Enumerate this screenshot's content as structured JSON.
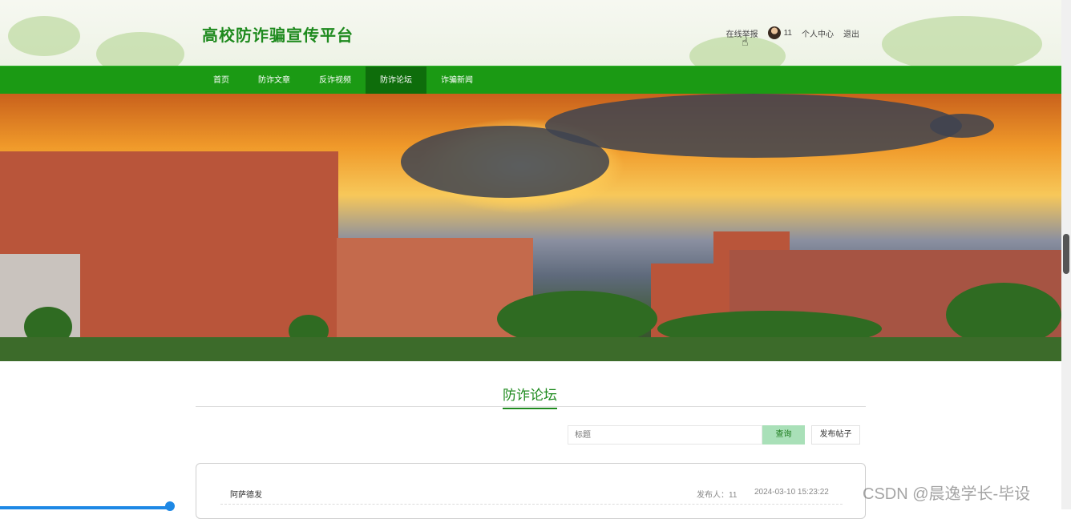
{
  "site": {
    "title": "高校防诈骗宣传平台"
  },
  "topbar": {
    "report_link": "在线举报",
    "username": "11",
    "profile_link": "个人中心",
    "logout_link": "退出"
  },
  "nav": {
    "items": [
      {
        "label": "首页"
      },
      {
        "label": "防诈文章"
      },
      {
        "label": "反诈视频"
      },
      {
        "label": "防诈论坛"
      },
      {
        "label": "诈骗新闻"
      }
    ],
    "active_index": 3
  },
  "section": {
    "title": "防诈论坛"
  },
  "search": {
    "placeholder": "标题",
    "button_label": "查询"
  },
  "post_button_label": "发布帖子",
  "posts": [
    {
      "title": "阿萨德发",
      "author_label": "发布人：11",
      "time": "2024-03-10 15:23:22"
    }
  ],
  "watermark": "CSDN @晨逸学长-毕设",
  "colors": {
    "primary_green": "#1b9a14",
    "nav_active": "#0e6d0b",
    "title_green": "#1e8a1e"
  }
}
